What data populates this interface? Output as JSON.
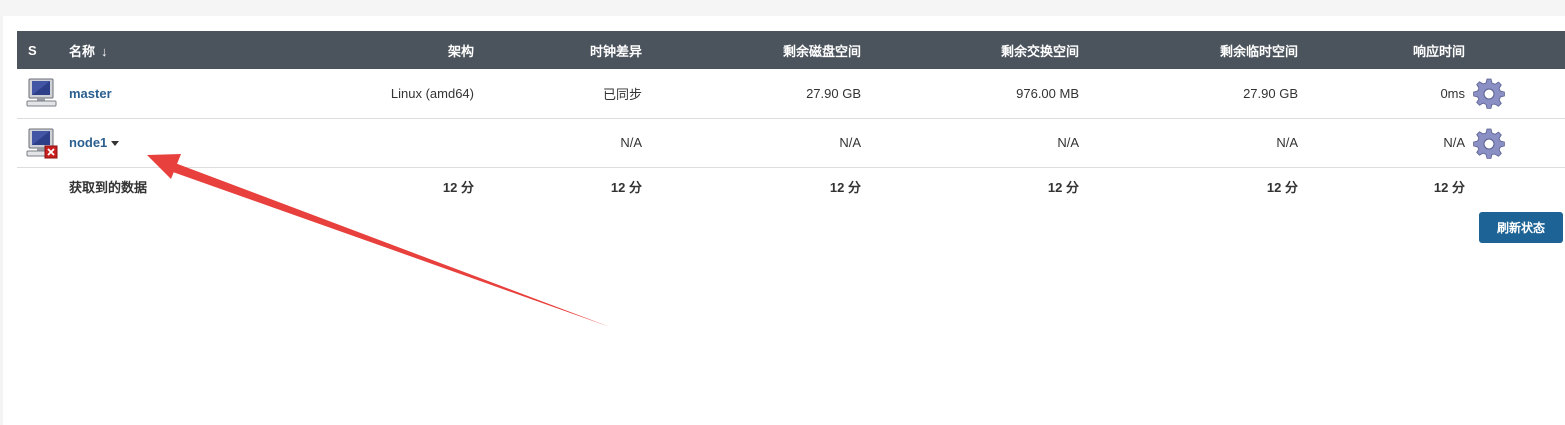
{
  "table": {
    "headers": {
      "status": "S",
      "name": "名称",
      "sort_indicator": "↓",
      "arch": "架构",
      "clock": "时钟差异",
      "disk": "剩余磁盘空间",
      "swap": "剩余交换空间",
      "temp": "剩余临时空间",
      "response": "响应时间"
    },
    "rows": [
      {
        "name": "master",
        "arch": "Linux (amd64)",
        "clock": "已同步",
        "disk": "27.90 GB",
        "swap": "976.00 MB",
        "temp": "27.90 GB",
        "response": "0ms",
        "status_icon": "computer-icon",
        "offline": false
      },
      {
        "name": "node1",
        "arch": "",
        "clock": "N/A",
        "disk": "N/A",
        "swap": "N/A",
        "temp": "N/A",
        "response": "N/A",
        "status_icon": "computer-offline-icon",
        "offline": true
      }
    ],
    "totals": {
      "label": "获取到的数据",
      "arch": "12 分",
      "clock": "12 分",
      "disk": "12 分",
      "swap": "12 分",
      "temp": "12 分",
      "response": "12 分"
    }
  },
  "refresh_button": {
    "label": "刷新状态"
  },
  "colors": {
    "header_bg": "#4b535c",
    "link": "#2b5f8f",
    "button_bg": "#1d6395",
    "annotation_arrow": "#e8403c"
  }
}
